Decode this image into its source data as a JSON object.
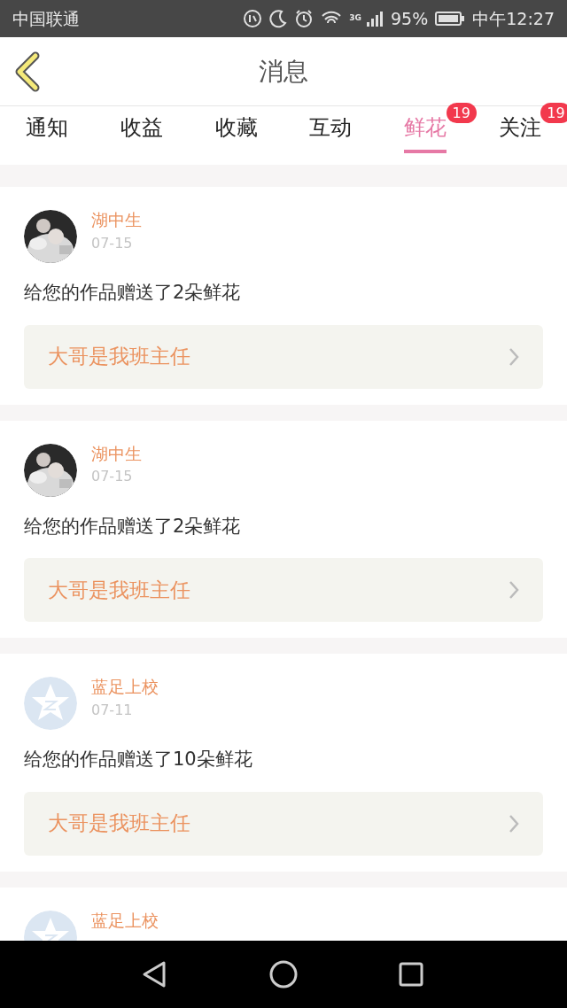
{
  "status_bar": {
    "carrier": "中国联通",
    "network": "3G",
    "battery": "95%",
    "time": "中午12:27"
  },
  "header": {
    "title": "消息"
  },
  "tabs": [
    {
      "label": "通知",
      "selected": false
    },
    {
      "label": "收益",
      "selected": false
    },
    {
      "label": "收藏",
      "selected": false
    },
    {
      "label": "互动",
      "selected": false
    },
    {
      "label": "鲜花",
      "selected": true,
      "badge": "19"
    },
    {
      "label": "关注",
      "selected": false,
      "badge": "19"
    }
  ],
  "messages": [
    {
      "name": "湖中生",
      "date": "07-15",
      "text": "给您的作品赠送了2朵鲜花",
      "work": "大哥是我班主任"
    },
    {
      "name": "湖中生",
      "date": "07-15",
      "text": "给您的作品赠送了2朵鲜花",
      "work": "大哥是我班主任"
    },
    {
      "avatar": {
        "kind": "default"
      },
      "name": "蓝足上校",
      "date": "07-11",
      "text": "给您的作品赠送了10朵鲜花",
      "work": "大哥是我班主任"
    },
    {
      "avatar": {
        "kind": "default"
      },
      "name": "蓝足上校"
    }
  ]
}
